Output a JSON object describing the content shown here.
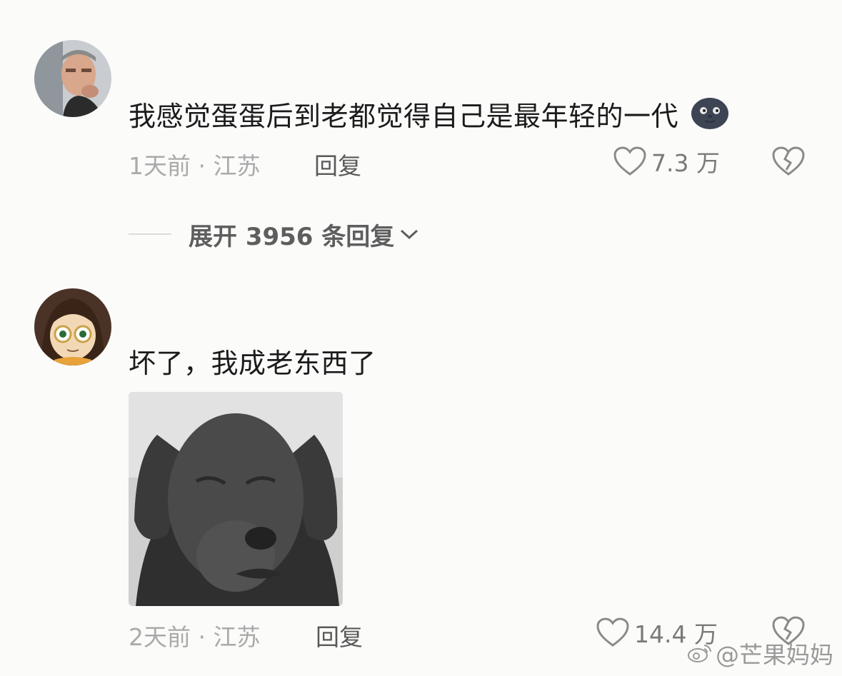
{
  "comments": [
    {
      "text": "我感觉蛋蛋后到老都觉得自己是最年轻的一代",
      "emoji": "moon-face-emoji",
      "time": "1天前",
      "separator": "·",
      "location": "江苏",
      "reply_label": "回复",
      "likes": "7.3 万"
    },
    {
      "text": "坏了，我成老东西了",
      "image": "sad-dog-meme",
      "time": "2天前",
      "separator": "·",
      "location": "江苏",
      "reply_label": "回复",
      "likes": "14.4 万"
    }
  ],
  "expand_replies": {
    "label": "展开 3956 条回复"
  },
  "watermark": {
    "icon": "weibo-icon",
    "text": "@芒果妈妈"
  },
  "colors": {
    "text": "#1b1b1b",
    "meta": "#aaaaaa",
    "reply": "#595959",
    "background": "#fbfbfa"
  }
}
